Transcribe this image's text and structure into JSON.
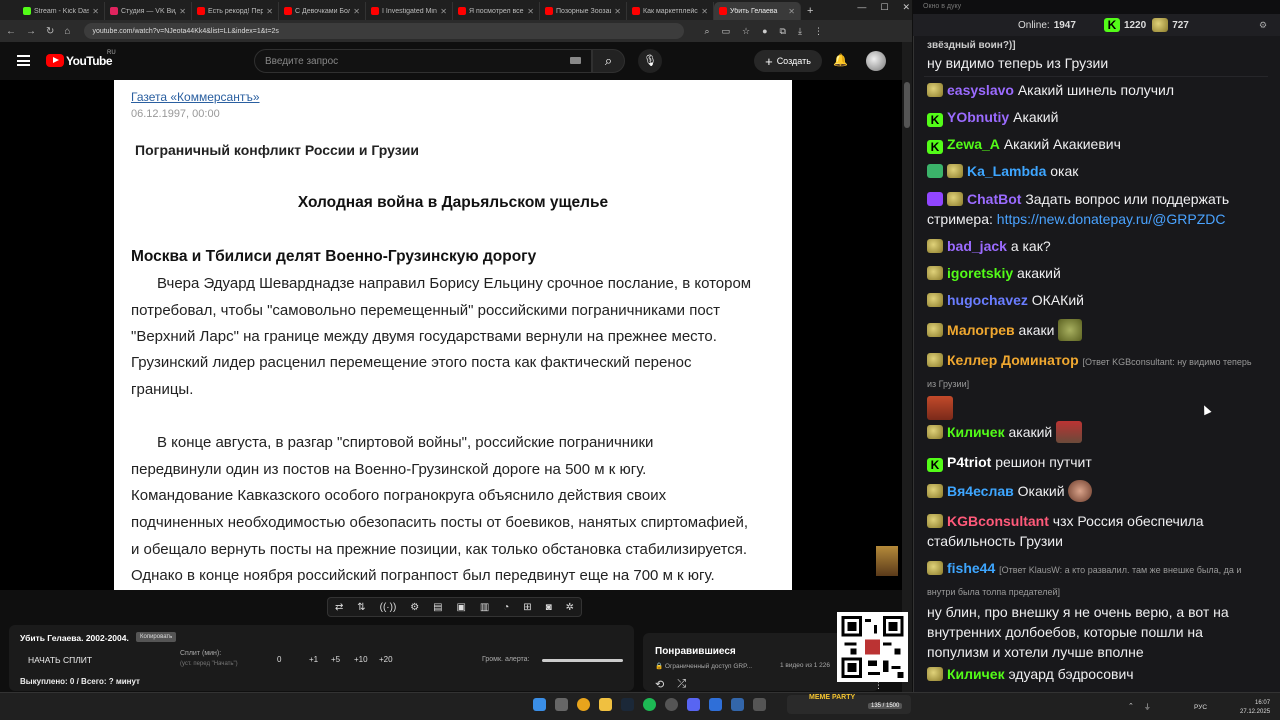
{
  "browser": {
    "tabs": [
      {
        "label": "Stream - Kick Dash",
        "color": "#53fc18"
      },
      {
        "label": "Студия — VK Видео",
        "color": "#e0245e"
      },
      {
        "label": "Есть рекорд! Пере",
        "color": "#ff0000"
      },
      {
        "label": "С Девочками Бол",
        "color": "#ff0000"
      },
      {
        "label": "I Investigated Min",
        "color": "#ff0000"
      },
      {
        "label": "Я посмотрел все с",
        "color": "#ff0000"
      },
      {
        "label": "Позорные Зоозащ",
        "color": "#ff0000"
      },
      {
        "label": "Как маркетплейс",
        "color": "#ff0000"
      },
      {
        "label": "Убить Гелаева",
        "color": "#ff0000",
        "active": true
      }
    ],
    "new_tab": "+",
    "url": "youtube.com/watch?v=NJeota44Kk4&list=LL&index=1&t=2s"
  },
  "youtube": {
    "logo_text": "YouTube",
    "region": "RU",
    "search_placeholder": "Введите запрос",
    "create_label": "Создать"
  },
  "document": {
    "source": "Газета «Коммерсантъ»",
    "date": "06.12.1997, 00:00",
    "rubric": "Пограничный конфликт России и Грузии",
    "title": "Холодная война в Дарьяльском ущелье",
    "subtitle": "Москва и Тбилиси делят Военно-Грузинскую дорогу",
    "lines": [
      "Вчера Эдуард Шеварднадзе направил Борису Ельцину срочное послание, в котором",
      "потребовал, чтобы \"самовольно перемещенный\" российскими пограничниками пост",
      "\"Верхний Ларс\" на границе между двумя государствами вернули на прежнее место.",
      "Грузинский лидер расценил перемещение этого поста как фактический перенос",
      "границы.",
      "В конце августа, в разгар \"спиртовой войны\", российские пограничники",
      "передвинули один из постов на Военно-Грузинской дороге на 500 м к югу.",
      "Командование Кавказского особого погранокруга объяснило действия своих",
      "подчиненных необходимостью обезопасить посты от боевиков, нанятых спиртомафией,",
      "и обещало вернуть посты на прежние позиции, как только обстановка стабилизируется.",
      "Однако в конце ноября российский погранпост был передвинут еще на 700 м к югу."
    ]
  },
  "player_panel": {
    "video_title": "Убить Гелаева. 2002-2004.",
    "copy_label": "Копировать",
    "start_split": "НАЧАТЬ СПЛИТ",
    "split_label": "Сплит (мин):",
    "split_hint": "(уст. перед \"Начать\")",
    "split_values": [
      "0",
      "+1",
      "+5",
      "+10",
      "+20"
    ],
    "alert_volume": "Громк. алерта:",
    "bought": "Выкуплено: 0 / Всего: ? минут"
  },
  "liked": {
    "title": "Понравившиеся",
    "meta": "🔒 Ограниченный доступ GRP...",
    "count": "1 видео из 1 226"
  },
  "widget": {
    "label": "MEME PARTY",
    "stat": "135 / 1500"
  },
  "chat": {
    "top_hint": "Окно в дуку",
    "online_label": "Online:",
    "online_value": "1947",
    "kick_value": "1220",
    "pepe_value": "727",
    "messages": [
      {
        "user": "",
        "text": "звёздный воин?)]",
        "partial": true
      },
      {
        "user": "",
        "text": "ну видимо теперь из Грузии"
      },
      {
        "user": "easyslavo",
        "color": "#9b6bff",
        "text": "Акакий шинель получил"
      },
      {
        "user": "YObnutiy",
        "color": "#9b6bff",
        "text": "Акакий"
      },
      {
        "user": "Zewa_A",
        "color": "#53fc18",
        "text": "Акакий Акакиевич"
      },
      {
        "user": "Ka_Lambda",
        "color": "#3ea6ff",
        "text": "окак"
      },
      {
        "user": "ChatBot",
        "color": "#9b6bff",
        "text": "Задать вопрос или поддержать стримера:",
        "link": "https://new.donatepay.ru/@GRPZDC"
      },
      {
        "user": "bad_jack",
        "color": "#9b6bff",
        "text": "а как?"
      },
      {
        "user": "igoretskiy",
        "color": "#53fc18",
        "text": "акакий"
      },
      {
        "user": "hugochavez",
        "color": "#6a7dff",
        "text": "ОКАКий"
      },
      {
        "user": "Малогрев",
        "color": "#f0a830",
        "text": "акаки"
      },
      {
        "user": "Келлер Доминатор",
        "color": "#f0a830",
        "reply": "[Ответ KGBconsultant: ну видимо теперь из Грузии]"
      },
      {
        "user": "Киличек",
        "color": "#53fc18",
        "text": "акакий"
      },
      {
        "user": "P4triot",
        "color": "#ffffff",
        "text": "решион путчит"
      },
      {
        "user": "Вя4еслав",
        "color": "#3ea6ff",
        "text": "Окакий"
      },
      {
        "user": "KGBconsultant",
        "color": "#ff5a7a",
        "text": "чзх Россия обеспечила стабильность Грузии"
      },
      {
        "user": "fishe44",
        "color": "#3ea6ff",
        "reply": "[Ответ KlausW: а кто развалил. там же внешке была, да и внутри была толпа предателей]",
        "text": "ну блин, про внешку я не очень верю, а вот на внутренних долбоебов, которые пошли на популизм и хотели лучше вполне"
      },
      {
        "user": "Киличек",
        "color": "#53fc18",
        "text": "эдуард бэдросович"
      }
    ]
  },
  "taskbar": {
    "lang": "РУС",
    "time": "16:07",
    "date": "27.12.2025"
  }
}
